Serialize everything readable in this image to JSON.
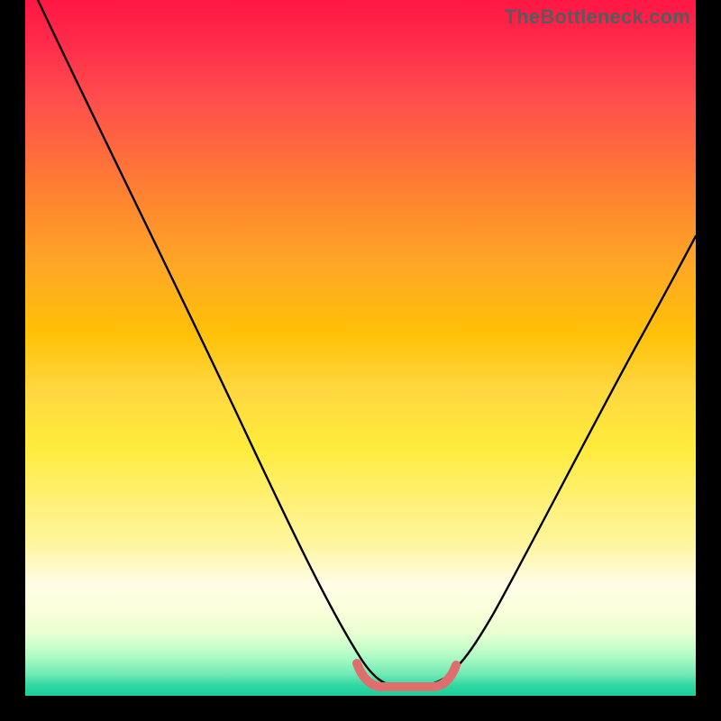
{
  "watermark": "TheBottleneck.com",
  "chart_data": {
    "type": "line",
    "title": "",
    "xlabel": "",
    "ylabel": "",
    "xlim": [
      0,
      100
    ],
    "ylim": [
      0,
      100
    ],
    "grid": false,
    "legend": false,
    "series": [
      {
        "name": "bottleneck-curve",
        "color": "#000000",
        "x": [
          2,
          10,
          20,
          30,
          40,
          48,
          52,
          55,
          58,
          62,
          65,
          70,
          80,
          90,
          100
        ],
        "y": [
          100,
          85,
          67,
          49,
          30,
          12,
          3,
          1,
          1,
          3,
          10,
          22,
          42,
          60,
          73
        ]
      },
      {
        "name": "optimal-range-marker",
        "color": "#e07070",
        "x": [
          50,
          52,
          54,
          56,
          58,
          60,
          62,
          64
        ],
        "y": [
          4,
          1.5,
          0.8,
          0.8,
          0.8,
          0.8,
          1.5,
          4
        ]
      }
    ],
    "background_gradient": {
      "direction": "vertical",
      "stops": [
        {
          "pos": 0,
          "color": "#ff1744"
        },
        {
          "pos": 50,
          "color": "#ffc107"
        },
        {
          "pos": 80,
          "color": "#fffde7"
        },
        {
          "pos": 100,
          "color": "#1ecc9b"
        }
      ]
    }
  }
}
